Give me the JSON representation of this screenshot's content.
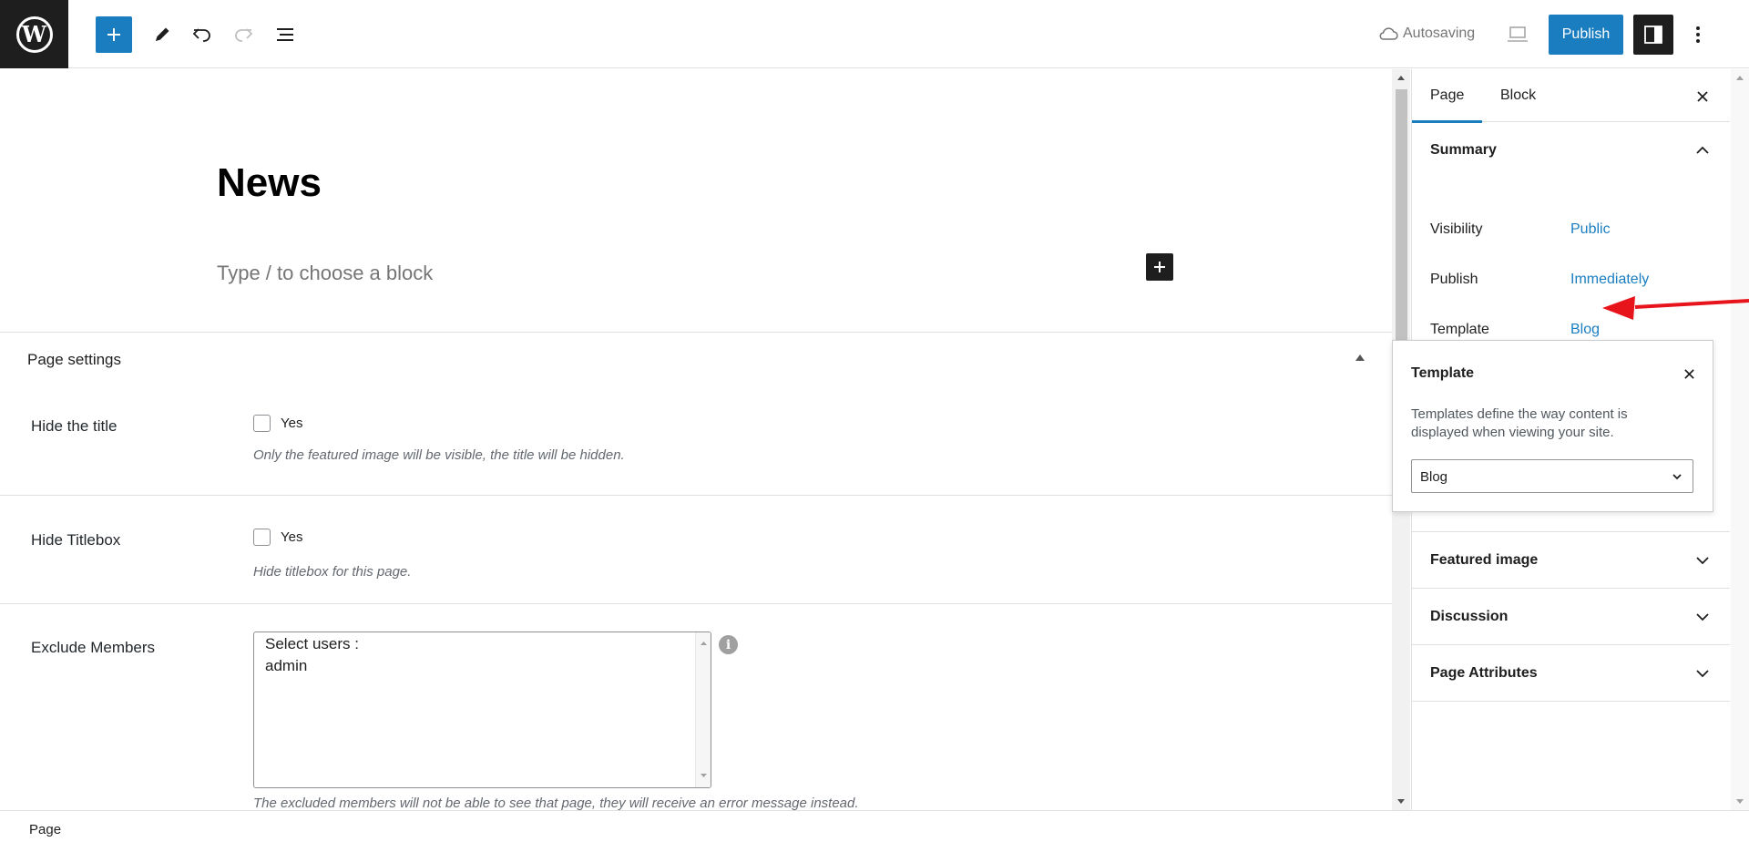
{
  "toolbar": {
    "autosave_label": "Autosaving",
    "publish_label": "Publish"
  },
  "editor": {
    "title": "News",
    "block_placeholder": "Type / to choose a block"
  },
  "page_settings": {
    "title": "Page settings",
    "hide_title": {
      "label": "Hide the title",
      "checkbox_label": "Yes",
      "description": "Only the featured image will be visible, the title will be hidden."
    },
    "hide_titlebox": {
      "label": "Hide Titlebox",
      "checkbox_label": "Yes",
      "description": "Hide titlebox for this page."
    },
    "exclude_members": {
      "label": "Exclude Members",
      "options": [
        "Select users :",
        "admin"
      ],
      "description": "The excluded members will not be able to see that page, they will receive an error message instead."
    }
  },
  "sidebar": {
    "tabs": [
      "Page",
      "Block"
    ],
    "summary": {
      "title": "Summary",
      "rows": [
        {
          "label": "Visibility",
          "value": "Public"
        },
        {
          "label": "Publish",
          "value": "Immediately"
        },
        {
          "label": "Template",
          "value": "Blog"
        }
      ]
    },
    "panels": [
      "Featured image",
      "Discussion",
      "Page Attributes"
    ]
  },
  "template_popover": {
    "title": "Template",
    "description": "Templates define the way content is displayed when viewing your site.",
    "selected": "Blog"
  },
  "footer": {
    "breadcrumb": "Page"
  },
  "colors": {
    "accent": "#1a7dc0",
    "dark": "#1e1e1e",
    "annotation_arrow": "#e8141b"
  }
}
